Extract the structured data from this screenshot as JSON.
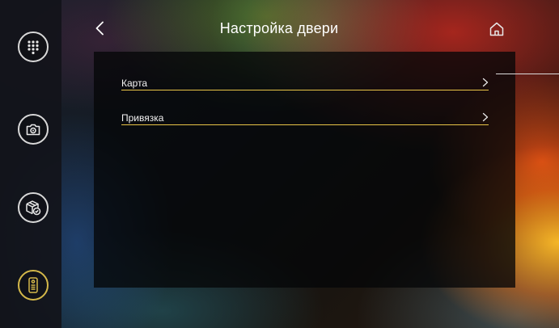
{
  "header": {
    "title": "Настройка двери",
    "back_icon": "chevron-left-icon",
    "home_icon": "home-icon"
  },
  "sidebar": {
    "items": [
      {
        "icon": "keypad-icon",
        "active": false
      },
      {
        "icon": "camera-settings-icon",
        "active": false
      },
      {
        "icon": "package-check-icon",
        "active": false
      },
      {
        "icon": "intercom-panel-icon",
        "active": true
      }
    ],
    "active_color": "#d4b84a"
  },
  "menu": {
    "items": [
      {
        "label": "Карта",
        "icon": "chevron-right-icon"
      },
      {
        "label": "Привязка",
        "icon": "chevron-right-icon"
      }
    ],
    "divider_color": "#e8c447"
  }
}
